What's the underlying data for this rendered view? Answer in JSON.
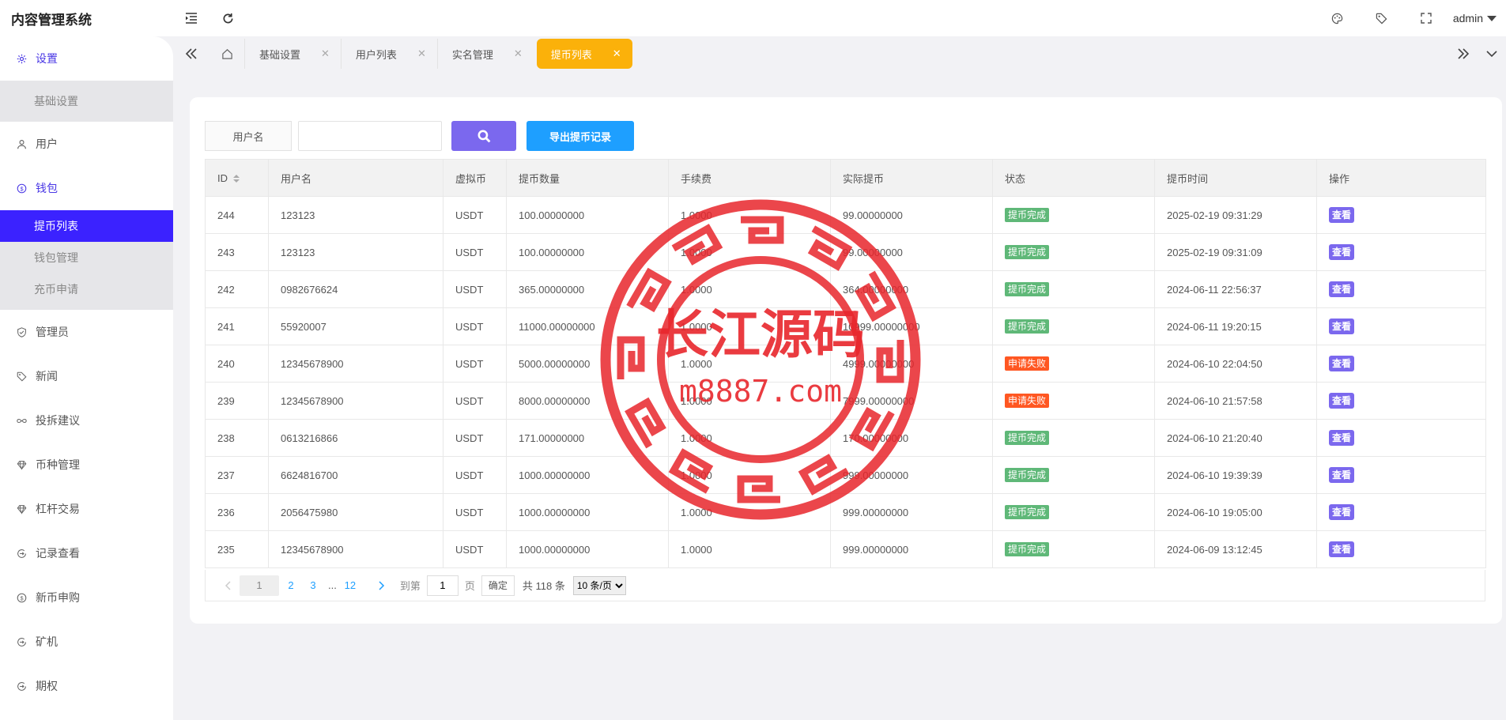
{
  "app": {
    "title": "内容管理系统"
  },
  "topbar": {
    "menu_icon": "menu-fold-icon",
    "refresh_icon": "refresh-icon",
    "user": "admin"
  },
  "sidebar": {
    "groups": [
      {
        "label": "设置",
        "icon": "gear-icon",
        "active": true,
        "children": [
          {
            "label": "基础设置"
          }
        ]
      },
      {
        "label": "用户",
        "icon": "user-icon"
      },
      {
        "label": "钱包",
        "icon": "dollar-icon",
        "active": true,
        "children": [
          {
            "label": "提币列表",
            "active": true
          },
          {
            "label": "钱包管理"
          },
          {
            "label": "充币申请"
          }
        ]
      },
      {
        "label": "管理员",
        "icon": "shield-icon"
      },
      {
        "label": "新闻",
        "icon": "tag-icon"
      },
      {
        "label": "投拆建议",
        "icon": "link-icon"
      },
      {
        "label": "币种管理",
        "icon": "diamond-icon"
      },
      {
        "label": "杠杆交易",
        "icon": "diamond-icon"
      },
      {
        "label": "记录查看",
        "icon": "circle-arrow-icon"
      },
      {
        "label": "新币申购",
        "icon": "dollar-icon"
      },
      {
        "label": "矿机",
        "icon": "circle-arrow-icon"
      },
      {
        "label": "期权",
        "icon": "circle-arrow-icon"
      }
    ]
  },
  "tabs": [
    {
      "label": "基础设置"
    },
    {
      "label": "用户列表"
    },
    {
      "label": "实名管理"
    },
    {
      "label": "提币列表",
      "active": true
    }
  ],
  "search": {
    "label": "用户名",
    "placeholder": "",
    "export_label": "导出提币记录"
  },
  "table": {
    "columns": [
      "ID",
      "用户名",
      "虚拟币",
      "提币数量",
      "手续费",
      "实际提币",
      "状态",
      "提币时间",
      "操作"
    ],
    "rows": [
      [
        "244",
        "123123",
        "USDT",
        "100.00000000",
        "1.0000",
        "99.00000000",
        "提币完成",
        "2025-02-19 09:31:29",
        "查看"
      ],
      [
        "243",
        "123123",
        "USDT",
        "100.00000000",
        "1.0000",
        "99.00000000",
        "提币完成",
        "2025-02-19 09:31:09",
        "查看"
      ],
      [
        "242",
        "0982676624",
        "USDT",
        "365.00000000",
        "1.0000",
        "364.00000000",
        "提币完成",
        "2024-06-11 22:56:37",
        "查看"
      ],
      [
        "241",
        "55920007",
        "USDT",
        "11000.00000000",
        "1.0000",
        "10999.00000000",
        "提币完成",
        "2024-06-11 19:20:15",
        "查看"
      ],
      [
        "240",
        "12345678900",
        "USDT",
        "5000.00000000",
        "1.0000",
        "4999.00000000",
        "申请失败",
        "2024-06-10 22:04:50",
        "查看"
      ],
      [
        "239",
        "12345678900",
        "USDT",
        "8000.00000000",
        "1.0000",
        "7999.00000000",
        "申请失败",
        "2024-06-10 21:57:58",
        "查看"
      ],
      [
        "238",
        "0613216866",
        "USDT",
        "171.00000000",
        "1.0000",
        "170.00000000",
        "提币完成",
        "2024-06-10 21:20:40",
        "查看"
      ],
      [
        "237",
        "6624816700",
        "USDT",
        "1000.00000000",
        "1.0000",
        "999.00000000",
        "提币完成",
        "2024-06-10 19:39:39",
        "查看"
      ],
      [
        "236",
        "2056475980",
        "USDT",
        "1000.00000000",
        "1.0000",
        "999.00000000",
        "提币完成",
        "2024-06-10 19:05:00",
        "查看"
      ],
      [
        "235",
        "12345678900",
        "USDT",
        "1000.00000000",
        "1.0000",
        "999.00000000",
        "提币完成",
        "2024-06-09 13:12:45",
        "查看"
      ]
    ],
    "status_colors": {
      "提币完成": "#5fb878",
      "申请失败": "#ff5722"
    }
  },
  "pager": {
    "current": "1",
    "pages": [
      "2",
      "3"
    ],
    "ellipsis": "...",
    "last": "12",
    "goto_label": "到第",
    "goto_value": "1",
    "page_unit": "页",
    "confirm": "确定",
    "total": "共 118 条",
    "page_size": "10 条/页"
  },
  "watermark": {
    "title": "长江源码",
    "url": "m8887.com",
    "color": "#e8262c"
  }
}
